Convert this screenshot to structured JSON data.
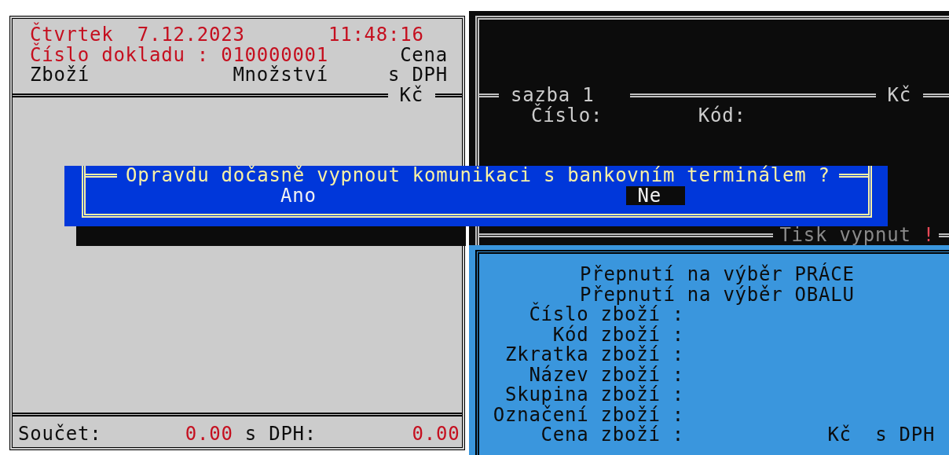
{
  "receipt": {
    "day": "Čtvrtek",
    "date": "7.12.2023",
    "time": "11:48:16",
    "document": "Číslo dokladu : 010000001",
    "price_label": "Cena",
    "columns": [
      "Zboží",
      "Množství",
      "s DPH"
    ],
    "currency": "Kč"
  },
  "totals": {
    "label": "Součet:",
    "value": "0.00",
    "vat_label": "s DPH:",
    "vat_value": "0.00"
  },
  "rate_panel": {
    "rate": "sazba 1",
    "currency": "Kč",
    "fields": [
      "Číslo:",
      "Kód:"
    ],
    "print_status": "Tisk vypnut",
    "print_alert": "!"
  },
  "item_panel": {
    "actions": [
      "Přepnutí na výběr PRÁCE",
      "Přepnutí na výběr OBALU"
    ],
    "fields": [
      {
        "label": "Číslo zboží :"
      },
      {
        "label": "Kód zboží :"
      },
      {
        "label": "Zkratka zboží :"
      },
      {
        "label": "Název zboží :"
      },
      {
        "label": "Skupina zboží :"
      },
      {
        "label": "Označení zboží :"
      },
      {
        "label": "Cena zboží :",
        "currency": "Kč",
        "vat": "s DPH"
      }
    ]
  },
  "dialog": {
    "title": "Opravdu dočasně vypnout komunikaci s bankovním terminálem ?",
    "options": [
      {
        "label": "Ano",
        "selected": false
      },
      {
        "label": "Ne",
        "selected": true
      }
    ]
  }
}
